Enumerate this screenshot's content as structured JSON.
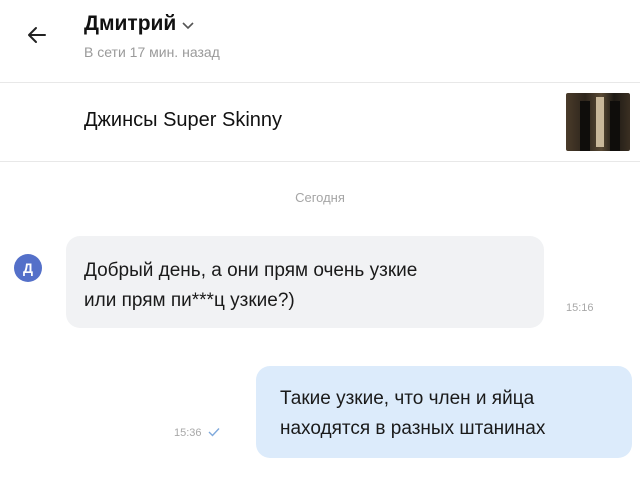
{
  "header": {
    "contact_name": "Дмитрий",
    "status": "В сети 17 мин. назад",
    "back_icon": "arrow-left-icon",
    "name_dropdown_icon": "chevron-down-icon"
  },
  "product": {
    "title": "Джинсы Super Skinny",
    "thumbnail": "product-thumbnail"
  },
  "chat": {
    "date_separator": "Сегодня",
    "messages": [
      {
        "direction": "incoming",
        "avatar_letter": "Д",
        "text_line1": "Добрый день, а они прям очень узкие",
        "text_line2": "или прям пи***ц узкие?)",
        "time": "15:16"
      },
      {
        "direction": "outgoing",
        "text_line1": "Такие узкие, что член и яйца",
        "text_line2": "находятся в разных штанинах",
        "time": "15:36",
        "status_icon": "checkmark-icon"
      }
    ]
  },
  "colors": {
    "avatar": "#5470c9",
    "incoming_bubble": "#f1f2f4",
    "outgoing_bubble": "#dcebfb",
    "read_check": "#7fa9dc"
  }
}
